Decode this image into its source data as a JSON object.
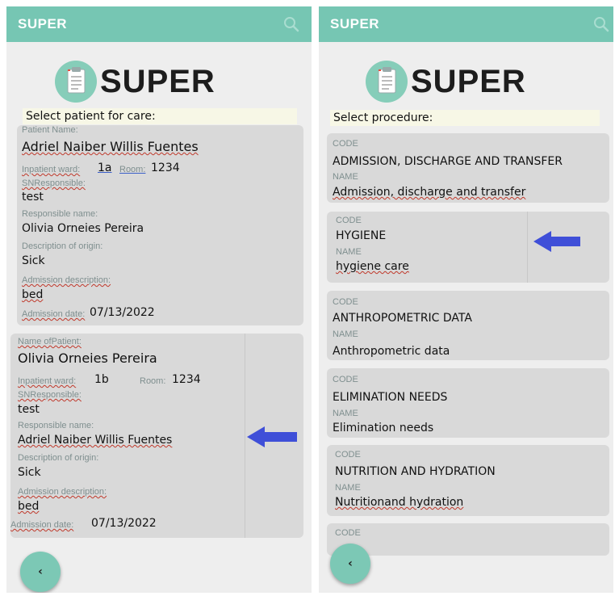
{
  "left": {
    "appbar_title": "SUPER",
    "logo_text": "SUPER",
    "select_title": "Select patient for care:",
    "patients": [
      {
        "name_label": "Patient Name:",
        "name": "Adriel Naiber Willis Fuentes",
        "ward_label": "Inpatient ward:",
        "ward": "1a",
        "room_label": "Room:",
        "room": "1234",
        "sn_label": "SNResponsible:",
        "sn": "test",
        "responsible_label": "Responsible name:",
        "responsible": "Olivia Orneies Pereira",
        "origin_label": "Description of origin:",
        "origin": "Sick",
        "admission_label": "Admission description:",
        "admission": "bed",
        "date_label": "Admission date:",
        "date": "07/13/2022"
      },
      {
        "name_label": "Name ofPatient:",
        "name": "Olivia Orneies Pereira",
        "ward_label": "Inpatient ward:",
        "ward": "1b",
        "room_label": "Room:",
        "room": "1234",
        "sn_label": "SNResponsible:",
        "sn": "test",
        "responsible_label": "Responsible name:",
        "responsible": "Adriel Naiber Willis Fuentes",
        "origin_label": "Description of origin:",
        "origin": "Sick",
        "admission_label": "Admission description:",
        "admission": "bed",
        "date_label": "Admission date:",
        "date": "07/13/2022"
      }
    ],
    "back_label": "‹"
  },
  "right": {
    "appbar_title": "SUPER",
    "logo_text": "SUPER",
    "select_title": "Select procedure:",
    "procedures": [
      {
        "code_label": "CODE",
        "code": "ADMISSION, DISCHARGE AND TRANSFER",
        "name_label": "NAME",
        "name": "Admission, discharge and transfer"
      },
      {
        "code_label": "CODE",
        "code": "HYGIENE",
        "name_label": "NAME",
        "name": "hygiene care"
      },
      {
        "code_label": "CODE",
        "code": "ANTHROPOMETRIC DATA",
        "name_label": "NAME",
        "name": "Anthropometric data"
      },
      {
        "code_label": "CODE",
        "code": "ELIMINATION NEEDS",
        "name_label": "NAME",
        "name": "Elimination needs"
      },
      {
        "code_label": "CODE",
        "code": "NUTRITION AND HYDRATION",
        "name_label": "NAME",
        "name": "Nutritionand hydration"
      },
      {
        "code_label": "CODE"
      }
    ],
    "back_label": "‹"
  },
  "colors": {
    "accent": "#76c6b3",
    "card": "#d9d9d9",
    "arrow": "#3f4fd8"
  },
  "icons": [
    "search-icon",
    "clipboard-icon",
    "back-icon",
    "arrow-left-icon"
  ]
}
